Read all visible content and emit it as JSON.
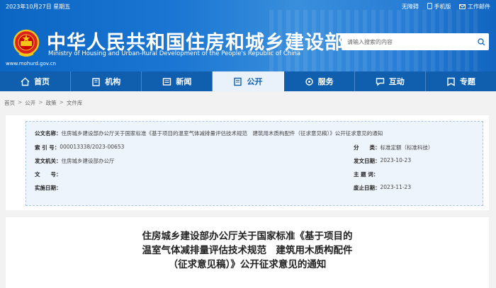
{
  "header": {
    "date": "2023年10月27日 星期五",
    "links": [
      "无障碍",
      "手机版",
      "工作邮件"
    ],
    "title": "中华人民共和国住房和城乡建设部",
    "subtitle": "Ministry of Housing and Urban-Rural Development of the People's Republic of China",
    "url": "www.mohurd.gov.cn",
    "search_placeholder": "请输入搜索的内容"
  },
  "nav": {
    "items": [
      {
        "label": "首页",
        "icon": "home-icon"
      },
      {
        "label": "机构",
        "icon": "building-icon"
      },
      {
        "label": "新闻",
        "icon": "news-icon"
      },
      {
        "label": "公开",
        "icon": "document-icon",
        "active": true
      },
      {
        "label": "服务",
        "icon": "service-icon"
      },
      {
        "label": "互动",
        "icon": "chat-icon"
      },
      {
        "label": "专题",
        "icon": "topic-icon"
      }
    ]
  },
  "breadcrumb": [
    "首页",
    "公开",
    "政策",
    "文件库"
  ],
  "info": {
    "doc_name_key": "公文名称：",
    "doc_name_value": "住房城乡建设部办公厅关于国家标准《基于项目的温室气体减排量评估技术规范　建筑用木质构配件（征求意见稿）》公开征求意见的通知",
    "index_key": "索 引 号：",
    "index_value": "000013338/2023-00653",
    "category_key": "分　　类：",
    "category_value": "标准定额（标准科技）",
    "issuer_key": "发文机关：",
    "issuer_value": "住房城乡建设部办公厅",
    "written_date_key": "发文日期：",
    "written_date_value": "2023-10-23",
    "doc_no_key": "文　　号：",
    "doc_no_value": "",
    "topic_key": "主 题 词：",
    "topic_value": "",
    "impl_date_key": "实施日期：",
    "impl_date_value": "",
    "deadline_key": "废止日期：",
    "deadline_value": "2023-11-23"
  },
  "document": {
    "title_lines": [
      "住房城乡建设部办公厅关于国家标准《基于项目的",
      "温室气体减排量评估技术规范　建筑用木质构配件",
      "（征求意见稿）》公开征求意见的通知"
    ]
  },
  "colors": {
    "header_blue": "#1a76d2",
    "nav_blue": "#0f5fae",
    "active_tab_bg": "#e9f2fb",
    "info_bg": "#eef4fb"
  }
}
